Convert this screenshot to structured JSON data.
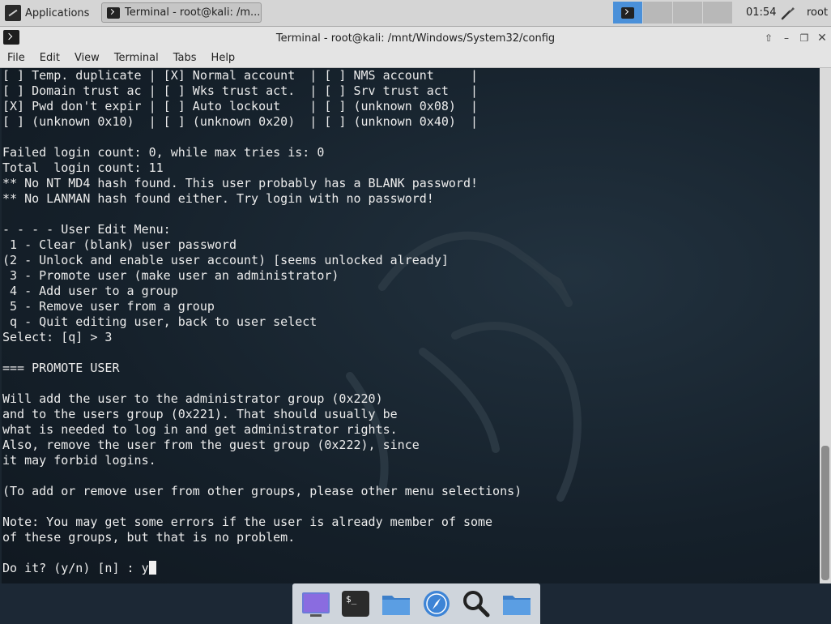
{
  "panel": {
    "applications_label": "Applications",
    "task_label": "Terminal - root@kali: /m...",
    "clock": "01:54",
    "user": "root",
    "workspaces": 4
  },
  "window": {
    "title": "Terminal - root@kali: /mnt/Windows/System32/config",
    "menu": [
      "File",
      "Edit",
      "View",
      "Terminal",
      "Tabs",
      "Help"
    ]
  },
  "terminal": {
    "lines": [
      "[ ] Temp. duplicate | [X] Normal account  | [ ] NMS account     |",
      "[ ] Domain trust ac | [ ] Wks trust act.  | [ ] Srv trust act   |",
      "[X] Pwd don't expir | [ ] Auto lockout    | [ ] (unknown 0x08)  |",
      "[ ] (unknown 0x10)  | [ ] (unknown 0x20)  | [ ] (unknown 0x40)  |",
      "",
      "Failed login count: 0, while max tries is: 0",
      "Total  login count: 11",
      "** No NT MD4 hash found. This user probably has a BLANK password!",
      "** No LANMAN hash found either. Try login with no password!",
      "",
      "- - - - User Edit Menu:",
      " 1 - Clear (blank) user password",
      "(2 - Unlock and enable user account) [seems unlocked already]",
      " 3 - Promote user (make user an administrator)",
      " 4 - Add user to a group",
      " 5 - Remove user from a group",
      " q - Quit editing user, back to user select",
      "Select: [q] > 3",
      "",
      "=== PROMOTE USER",
      "",
      "Will add the user to the administrator group (0x220)",
      "and to the users group (0x221). That should usually be",
      "what is needed to log in and get administrator rights.",
      "Also, remove the user from the guest group (0x222), since",
      "it may forbid logins.",
      "",
      "(To add or remove user from other groups, please other menu selections)",
      "",
      "Note: You may get some errors if the user is already member of some",
      "of these groups, but that is no problem.",
      "",
      "Do it? (y/n) [n] : y"
    ]
  },
  "dock": {
    "icons": [
      "desktop-icon",
      "terminal-icon",
      "file-manager-icon",
      "browser-icon",
      "search-icon",
      "folder-icon"
    ]
  },
  "colors": {
    "terminal_bg": "#15202a",
    "terminal_fg": "#ececec",
    "accent": "#4a90d9"
  }
}
